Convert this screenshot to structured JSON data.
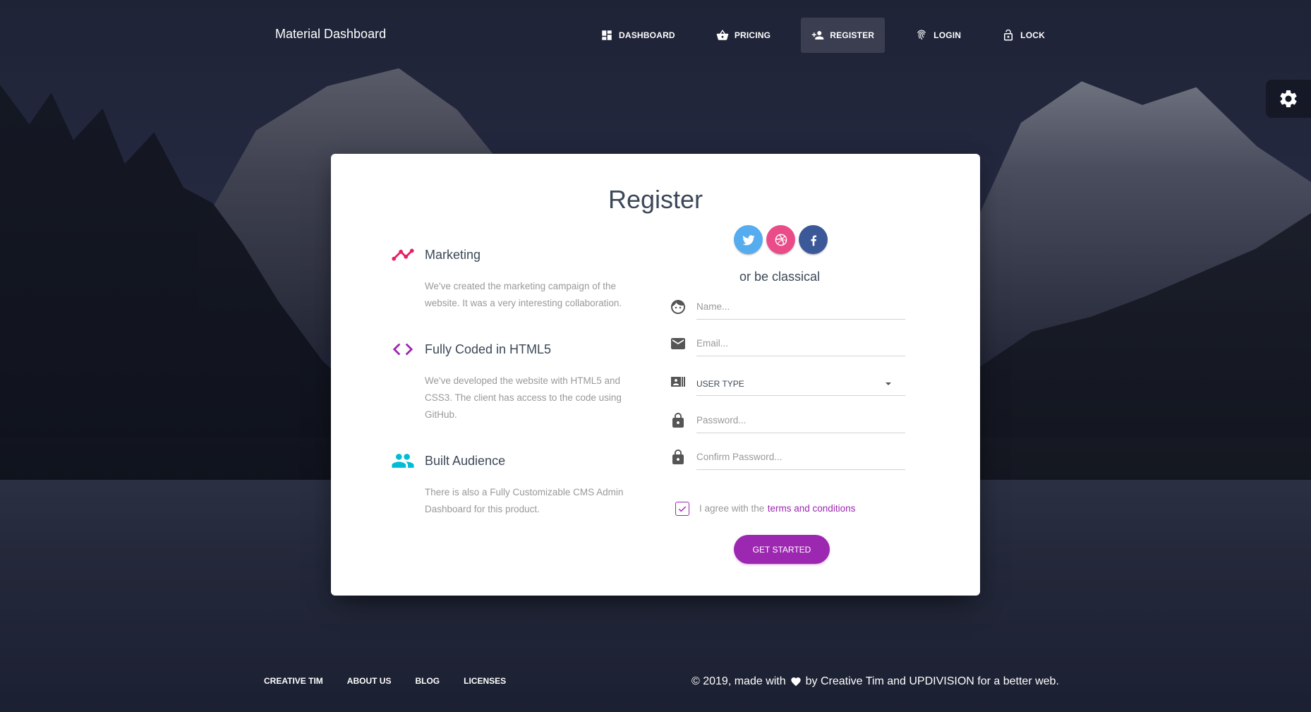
{
  "brand": "Material Dashboard",
  "nav": {
    "items": [
      {
        "label": "DASHBOARD",
        "icon": "dashboard-icon"
      },
      {
        "label": "PRICING",
        "icon": "basket-icon"
      },
      {
        "label": "REGISTER",
        "icon": "person-add-icon",
        "active": true
      },
      {
        "label": "LOGIN",
        "icon": "fingerprint-icon"
      },
      {
        "label": "LOCK",
        "icon": "lock-open-icon"
      }
    ]
  },
  "card": {
    "title": "Register",
    "info": [
      {
        "title": "Marketing",
        "desc": "We've created the marketing campaign of the website. It was a very interesting collaboration.",
        "icon": "timeline-icon",
        "color": "#e91e63"
      },
      {
        "title": "Fully Coded in HTML5",
        "desc": "We've developed the website with HTML5 and CSS3. The client has access to the code using GitHub.",
        "icon": "code-icon",
        "color": "#9c27b0"
      },
      {
        "title": "Built Audience",
        "desc": "There is also a Fully Customizable CMS Admin Dashboard for this product.",
        "icon": "group-icon",
        "color": "#00bcd4"
      }
    ],
    "social": [
      "twitter-icon",
      "dribbble-icon",
      "facebook-icon"
    ],
    "classical": "or be classical",
    "form": {
      "name_placeholder": "Name...",
      "email_placeholder": "Email...",
      "user_type": "USER TYPE",
      "password_placeholder": "Password...",
      "confirm_placeholder": "Confirm Password..."
    },
    "agree_text": "I agree with the",
    "agree_link": "terms and conditions",
    "agree_checked": true,
    "submit": "GET STARTED"
  },
  "footer": {
    "links": [
      "CREATIVE TIM",
      "ABOUT US",
      "BLOG",
      "LICENSES"
    ],
    "copyright_prefix": "© 2019, made with",
    "copyright_suffix": "by Creative Tim and UPDIVISION for a better web."
  },
  "colors": {
    "primary": "#9c27b0",
    "twitter": "#55acee",
    "dribbble": "#ea4c89",
    "facebook": "#3b5998"
  }
}
